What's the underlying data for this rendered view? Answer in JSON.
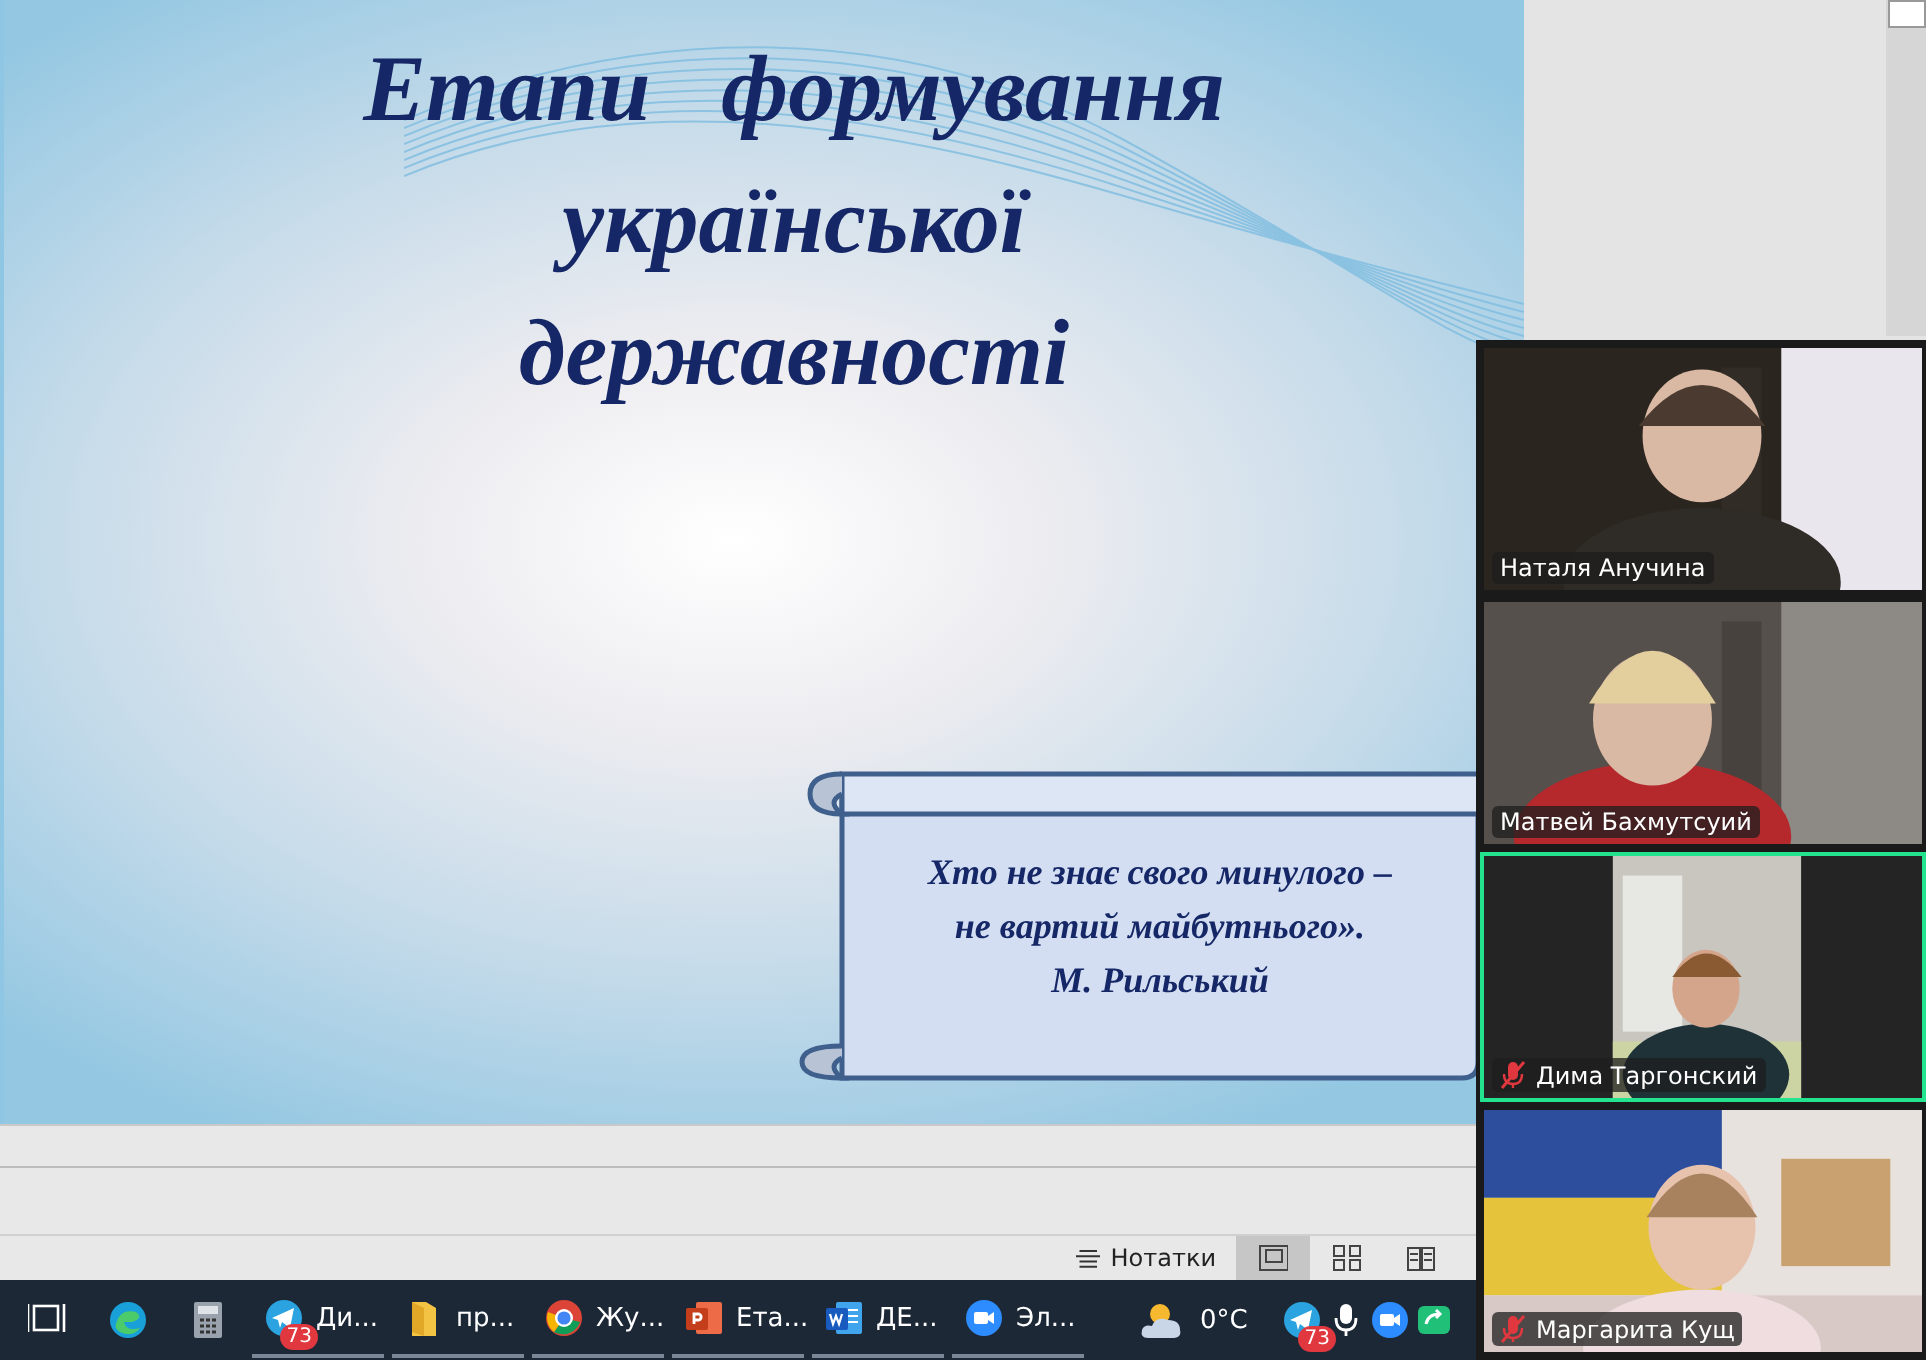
{
  "slide": {
    "title_lines": [
      "Етапи   формування",
      "української",
      "державності"
    ],
    "quote_lines": [
      "Хто не знає свого минулого –",
      "не вартий майбутнього».",
      "М. Рильський"
    ]
  },
  "status_bar": {
    "notes_button": "Нотатки",
    "views": [
      {
        "kind": "normal",
        "selected": true
      },
      {
        "kind": "sorter",
        "selected": false
      },
      {
        "kind": "reading",
        "selected": false
      }
    ]
  },
  "taskbar": {
    "apps": [
      {
        "kind": "taskview"
      },
      {
        "kind": "edge"
      },
      {
        "kind": "calculator"
      },
      {
        "kind": "telegram",
        "label": "Ди...",
        "badge": "73"
      },
      {
        "kind": "folder",
        "label": "пр..."
      },
      {
        "kind": "chrome",
        "label": "Жу..."
      },
      {
        "kind": "powerpoint",
        "label": "Ета..."
      },
      {
        "kind": "word",
        "label": "ДЕ..."
      },
      {
        "kind": "zoom",
        "label": "Эл..."
      }
    ],
    "weather": "0°C",
    "tray": [
      {
        "kind": "telegram",
        "badge": "73"
      },
      {
        "kind": "mic"
      },
      {
        "kind": "zoom"
      },
      {
        "kind": "share"
      }
    ]
  },
  "video_panel": {
    "participants": [
      {
        "name": "Наталя Анучина",
        "muted": false,
        "active": false,
        "kind": "wide"
      },
      {
        "name": "Матвей Бахмутсуий",
        "muted": false,
        "active": false,
        "kind": "wide"
      },
      {
        "name": "Дима Таргонский",
        "muted": true,
        "active": true,
        "kind": "portrait"
      },
      {
        "name": "Маргарита Кущ",
        "muted": true,
        "active": false,
        "kind": "flag"
      }
    ]
  }
}
